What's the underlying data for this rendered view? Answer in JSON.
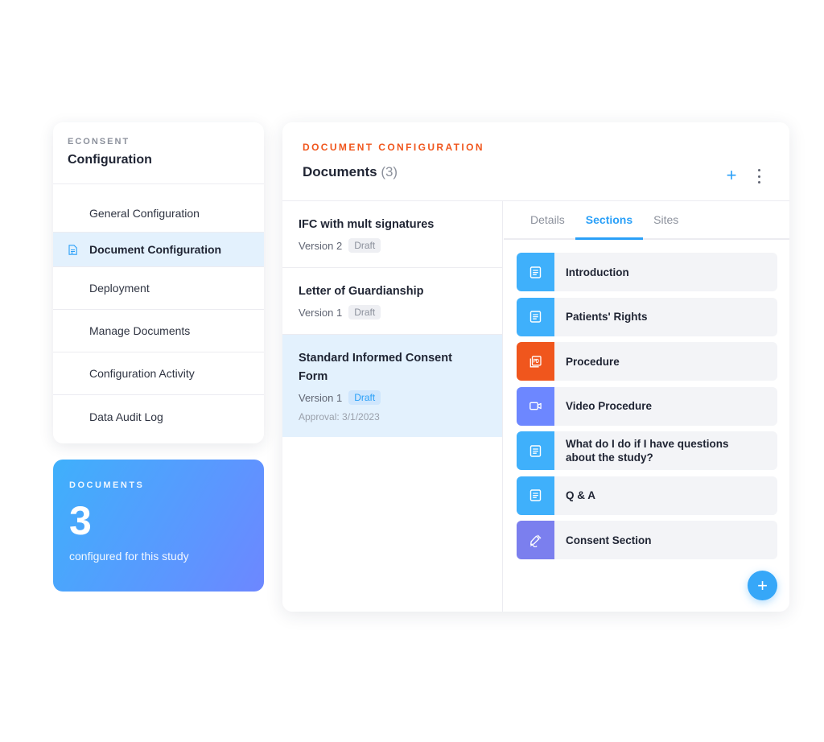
{
  "sidebar": {
    "eyebrow": "ECONSENT",
    "title": "Configuration",
    "items": [
      {
        "label": "General Configuration"
      },
      {
        "label": "Document Configuration"
      },
      {
        "label": "Deployment"
      },
      {
        "label": "Manage Documents"
      },
      {
        "label": "Configuration Activity"
      },
      {
        "label": "Data Audit Log"
      }
    ]
  },
  "stats": {
    "eyebrow": "DOCUMENTS",
    "count": "3",
    "subtitle": "configured for this study"
  },
  "main": {
    "eyebrow": "DOCUMENT CONFIGURATION",
    "title": "Documents",
    "count": "(3)",
    "add_icon": "+",
    "documents": [
      {
        "name": "IFC with mult signatures",
        "version": "Version 2",
        "status": "Draft"
      },
      {
        "name": "Letter of Guardianship",
        "version": "Version 1",
        "status": "Draft"
      },
      {
        "name": "Standard Informed Consent Form",
        "version": "Version 1",
        "status": "Draft",
        "approval": "Approval: 3/1/2023"
      }
    ],
    "tabs": [
      {
        "label": "Details"
      },
      {
        "label": "Sections"
      },
      {
        "label": "Sites"
      }
    ],
    "sections": [
      {
        "label": "Introduction",
        "icon": "document-icon",
        "color": "#3fb0fb"
      },
      {
        "label": "Patients' Rights",
        "icon": "document-icon",
        "color": "#3fb0fb"
      },
      {
        "label": "Procedure",
        "icon": "pdf-icon",
        "color": "#f0561d"
      },
      {
        "label": "Video Procedure",
        "icon": "video-icon",
        "color": "#6d87ff"
      },
      {
        "label": "What do I do if I have questions about the study?",
        "icon": "document-icon",
        "color": "#3fb0fb"
      },
      {
        "label": "Q & A",
        "icon": "document-icon",
        "color": "#3fb0fb"
      },
      {
        "label": "Consent Section",
        "icon": "signature-icon",
        "color": "#7b7fee"
      }
    ],
    "fab_icon": "+"
  },
  "colors": {
    "accent": "#2aa0f8",
    "orange": "#f0561d",
    "selected_bg": "#e3f1fd"
  }
}
